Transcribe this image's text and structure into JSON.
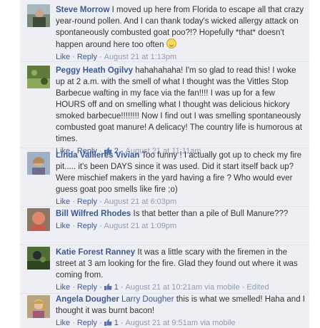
{
  "comments": [
    {
      "author": "Steve Morrow",
      "text": "I moved up here from Florida to escape all that crazy year-round pollen. And I can thank today's wicked allergy attack on spontaneously combusted goat poo?!? Hopefully *that* doesn't happen around here too often",
      "like": "Like",
      "reply": "Reply",
      "likes": "",
      "timestamp": "August 21 at 1:13pm",
      "extra": ""
    },
    {
      "author": "Peggy Heath Ogilvy",
      "text": "hahahahaha! I'm so glad to read this! I woke up at 2 a.m. with the smell of what I thought was the Vittles Stop Barbecue wafting in my face via the fan!!!! I was up for a few HOURS off and on smelling what I thought was delicious hickory smoked barbecue!!!!!!!! Now I find out I was smelling spontaneously combusted goat manure! A delicacy! The country life is humorous at times.",
      "like": "Like",
      "reply": "Reply",
      "likes": "2",
      "timestamp": "August 21 at 11:11am",
      "extra": ""
    },
    {
      "author": "Linda Vallieres Vivian",
      "text": "Too funny ! I actually got up to check my fire pit..... it's been DAYS since it was used. Did it start itself back up? Were mischief makers in the yard having a fire ? Who would ever guess goat poo smells like fire ;o)",
      "like": "Like",
      "reply": "Reply",
      "likes": "",
      "timestamp": "August 21 at 6:03pm",
      "extra": ""
    },
    {
      "author": "Bill Wilfred Rhodes",
      "text": "Is that better than a pile of Bull Manure???",
      "like": "Like",
      "reply": "Reply",
      "likes": "",
      "timestamp": "August 21 at 1:09pm",
      "extra": ""
    },
    {
      "author": "Katie Forest Ranney",
      "text": "It was a little scary with the firemen in the street at 3 am looking for the fire. Glad they found out where it was coming from.",
      "like": "Like",
      "reply": "Reply",
      "likes": "1",
      "timestamp": "August 21 at 10:21am via mobile",
      "extra": "Edited"
    },
    {
      "author": "Angela Dougher",
      "mention": "Larry Dougher",
      "text": "this is what we smelled! Haha and I thought it was burnt bacon!",
      "like": "Like",
      "reply": "Reply",
      "likes": "1",
      "timestamp": "August 21 at 9:51am via mobile",
      "extra": ""
    }
  ]
}
